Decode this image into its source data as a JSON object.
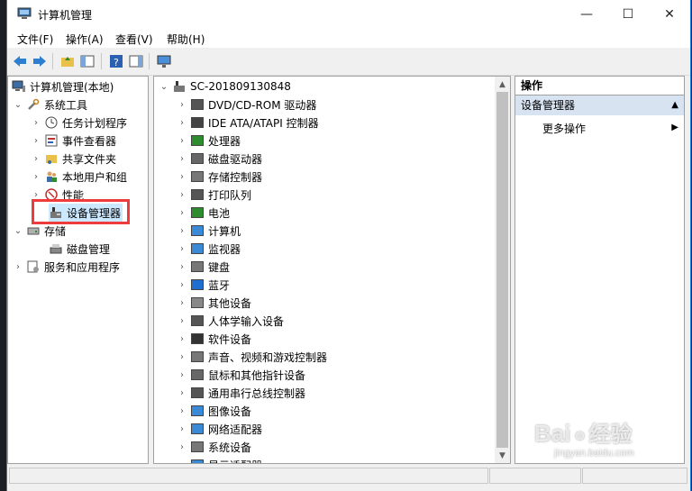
{
  "window": {
    "title": "计算机管理",
    "minimize": "—",
    "maximize": "☐",
    "close": "✕"
  },
  "menu": [
    "文件(F)",
    "操作(A)",
    "查看(V)",
    "帮助(H)"
  ],
  "left_tree": {
    "root": "计算机管理(本地)",
    "items": [
      {
        "label": "系统工具",
        "expanded": true
      },
      {
        "label": "任务计划程序"
      },
      {
        "label": "事件查看器"
      },
      {
        "label": "共享文件夹"
      },
      {
        "label": "本地用户和组"
      },
      {
        "label": "性能"
      },
      {
        "label": "设备管理器",
        "selected": true
      },
      {
        "label": "存储",
        "expanded": true
      },
      {
        "label": "磁盘管理"
      },
      {
        "label": "服务和应用程序"
      }
    ]
  },
  "device_tree": {
    "root": "SC-201809130848",
    "categories": [
      "DVD/CD-ROM 驱动器",
      "IDE ATA/ATAPI 控制器",
      "处理器",
      "磁盘驱动器",
      "存储控制器",
      "打印队列",
      "电池",
      "计算机",
      "监视器",
      "键盘",
      "蓝牙",
      "其他设备",
      "人体学输入设备",
      "软件设备",
      "声音、视频和游戏控制器",
      "鼠标和其他指针设备",
      "通用串行总线控制器",
      "图像设备",
      "网络适配器",
      "系统设备",
      "显示适配器"
    ]
  },
  "actions": {
    "header": "操作",
    "section": "设备管理器",
    "more": "更多操作"
  },
  "watermark": {
    "line1": "Bai",
    "line2": "经验",
    "line3": "jingyan.baidu.com"
  },
  "colors": {
    "accent": "#1883d7",
    "highlight": "#ee3c3c",
    "section_bg": "#d8e3f2"
  }
}
